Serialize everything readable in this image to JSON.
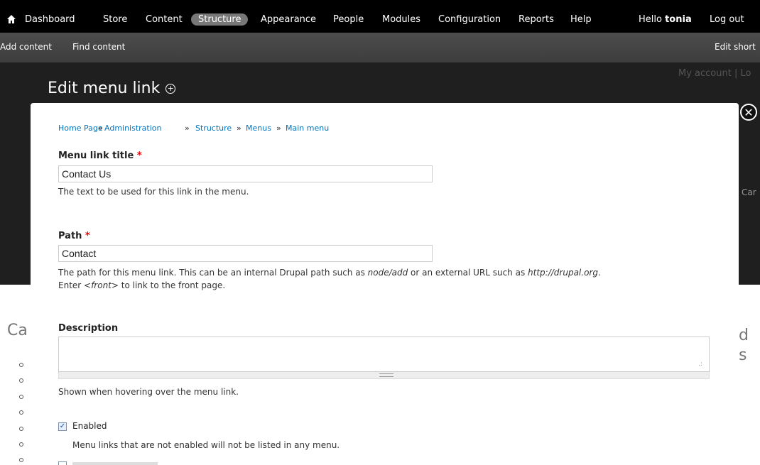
{
  "toolbar": {
    "items": [
      "Dashboard",
      "Store",
      "Content",
      "Structure",
      "Appearance",
      "People",
      "Modules",
      "Configuration",
      "Reports",
      "Help"
    ],
    "hello": "Hello",
    "user": "tonia",
    "logout": "Log out"
  },
  "shortcuts": {
    "add_content": "Add content",
    "find_content": "Find content",
    "edit_shortcuts": "Edit short"
  },
  "background": {
    "page_title": "Edit menu link",
    "account": "My account | Lo",
    "frag_left": "Ca",
    "frag_right1": "d",
    "frag_right2": "s",
    "frag_car": "Car"
  },
  "modal": {
    "breadcrumb": [
      "Home Page",
      "Administration",
      "Structure",
      "Menus",
      "Main menu"
    ],
    "breadcrumb_sep": "»",
    "title_label": "Menu link title",
    "required": "*",
    "title_value": "Contact Us",
    "title_desc": "The text to be used for this link in the menu.",
    "path_label": "Path",
    "path_value": "Contact",
    "path_desc_a": "The path for this menu link. This can be an internal Drupal path such as ",
    "path_desc_node": "node/add",
    "path_desc_b": " or an external URL such as ",
    "path_desc_url": "http://drupal.org",
    "path_desc_c": ".",
    "path_desc2_a": "Enter ",
    "path_desc2_front": "<front>",
    "path_desc2_b": " to link to the front page.",
    "description_label": "Description",
    "description_desc": "Shown when hovering over the menu link.",
    "enabled_label": "Enabled",
    "enabled_desc": "Menu links that are not enabled will not be listed in any menu.",
    "enabled_checked": true
  }
}
